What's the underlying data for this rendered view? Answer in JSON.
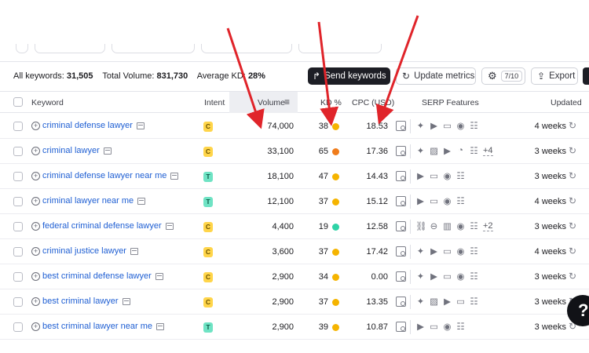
{
  "summary": {
    "all_keywords_label": "All keywords:",
    "all_keywords_value": "31,505",
    "total_volume_label": "Total Volume:",
    "total_volume_value": "831,730",
    "avg_kd_label": "Average KD:",
    "avg_kd_value": "28%"
  },
  "toolbar": {
    "send_keywords": "Send keywords",
    "update_metrics": "Update metrics",
    "gear_badge": "7/10",
    "export": "Export"
  },
  "columns": {
    "keyword": "Keyword",
    "intent": "Intent",
    "volume": "Volume",
    "kd": "KD %",
    "cpc": "CPC (USD)",
    "serp": "SERP Features",
    "updated": "Updated"
  },
  "rows": [
    {
      "keyword": "criminal defense lawyer",
      "intent": "C",
      "volume": "74,000",
      "kd": "38",
      "kd_color": "#f5b400",
      "cpc": "18.53",
      "features": [
        "✦",
        "▶",
        "▭",
        "◉",
        "☷"
      ],
      "more": "",
      "updated": "4 weeks"
    },
    {
      "keyword": "criminal lawyer",
      "intent": "C",
      "volume": "33,100",
      "kd": "65",
      "kd_color": "#f07c1b",
      "cpc": "17.36",
      "features": [
        "✦",
        "▨",
        "▶",
        "◔",
        "☷"
      ],
      "more": "+4",
      "updated": "3 weeks"
    },
    {
      "keyword": "criminal defense lawyer near me",
      "intent": "T",
      "volume": "18,100",
      "kd": "47",
      "kd_color": "#f5b400",
      "cpc": "14.43",
      "features": [
        "▶",
        "▭",
        "◉",
        "☷"
      ],
      "more": "",
      "updated": "3 weeks"
    },
    {
      "keyword": "criminal lawyer near me",
      "intent": "T",
      "volume": "12,100",
      "kd": "37",
      "kd_color": "#f5b400",
      "cpc": "15.12",
      "features": [
        "▶",
        "▭",
        "◉",
        "☷"
      ],
      "more": "",
      "updated": "4 weeks"
    },
    {
      "keyword": "federal criminal defense lawyer",
      "intent": "C",
      "volume": "4,400",
      "kd": "19",
      "kd_color": "#2ed3a6",
      "cpc": "12.58",
      "features": [
        "⛓",
        "⊖",
        "▥",
        "◉",
        "☷"
      ],
      "more": "+2",
      "updated": "3 weeks"
    },
    {
      "keyword": "criminal justice lawyer",
      "intent": "C",
      "volume": "3,600",
      "kd": "37",
      "kd_color": "#f5b400",
      "cpc": "17.42",
      "features": [
        "✦",
        "▶",
        "▭",
        "◉",
        "☷"
      ],
      "more": "",
      "updated": "4 weeks"
    },
    {
      "keyword": "best criminal defense lawyer",
      "intent": "C",
      "volume": "2,900",
      "kd": "34",
      "kd_color": "#f5b400",
      "cpc": "0.00",
      "features": [
        "✦",
        "▶",
        "▭",
        "◉",
        "☷"
      ],
      "more": "",
      "updated": "3 weeks"
    },
    {
      "keyword": "best criminal lawyer",
      "intent": "C",
      "volume": "2,900",
      "kd": "37",
      "kd_color": "#f5b400",
      "cpc": "13.35",
      "features": [
        "✦",
        "▨",
        "▶",
        "▭",
        "☷"
      ],
      "more": "",
      "updated": "3 weeks"
    },
    {
      "keyword": "best criminal lawyer near me",
      "intent": "T",
      "volume": "2,900",
      "kd": "39",
      "kd_color": "#f5b400",
      "cpc": "10.87",
      "features": [
        "▶",
        "▭",
        "◉",
        "☷"
      ],
      "more": "",
      "updated": "3 weeks"
    }
  ],
  "help_label": "?",
  "colors": {
    "link": "#1f5fd3",
    "arrow": "#e0242a",
    "dark_button": "#1d1e25"
  }
}
